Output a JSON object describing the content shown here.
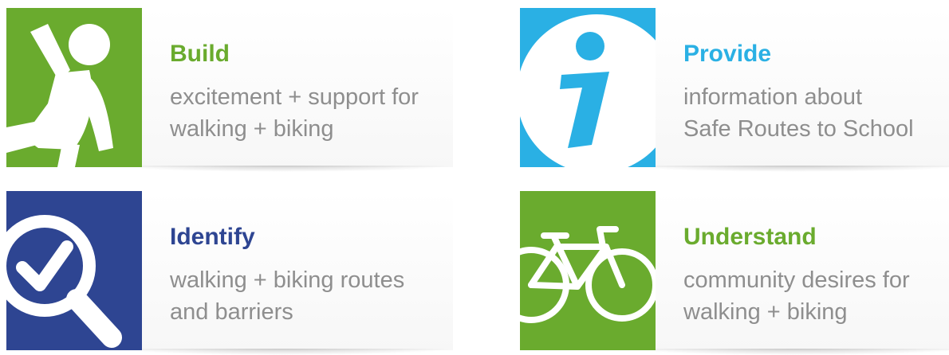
{
  "colors": {
    "green": "#6aab2e",
    "cyan": "#2ab0e4",
    "navy": "#2e4592",
    "body_text": "#8e8e8e"
  },
  "cards": [
    {
      "title": "Build",
      "line1": "excitement + support for",
      "line2": "walking + biking",
      "icon": "child-running-icon",
      "color": "#6aab2e"
    },
    {
      "title": "Provide",
      "line1": "information about",
      "line2": "Safe Routes to School",
      "icon": "info-icon",
      "color": "#2ab0e4"
    },
    {
      "title": "Identify",
      "line1": "walking + biking routes",
      "line2": "and barriers",
      "icon": "magnifier-check-icon",
      "color": "#2e4592"
    },
    {
      "title": "Understand",
      "line1": "community desires for",
      "line2": "walking + biking",
      "icon": "bicycle-icon",
      "color": "#6aab2e"
    }
  ]
}
